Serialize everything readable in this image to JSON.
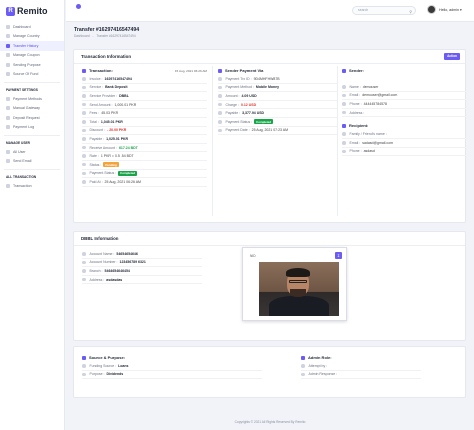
{
  "brand": {
    "name": "Remito",
    "logo_letter": "R"
  },
  "sidebar": {
    "main_items": [
      {
        "label": "Dashboard",
        "icon": "dashboard-icon"
      },
      {
        "label": "Manage Country",
        "icon": "globe-icon"
      },
      {
        "label": "Transfer History",
        "icon": "history-icon"
      },
      {
        "label": "Manage Coupon",
        "icon": "coupon-icon"
      },
      {
        "label": "Sending Purpose",
        "icon": "purpose-icon"
      },
      {
        "label": "Source Of Fund",
        "icon": "fund-icon"
      }
    ],
    "payment_heading": "PAYMENT SETTINGS",
    "payment_items": [
      {
        "label": "Payment Methods",
        "icon": "card-icon"
      },
      {
        "label": "Manual Gateway",
        "icon": "gateway-icon"
      },
      {
        "label": "Deposit Request",
        "icon": "deposit-icon"
      },
      {
        "label": "Payment Log",
        "icon": "log-icon"
      }
    ],
    "user_heading": "MANAGE USER",
    "user_items": [
      {
        "label": "All User",
        "icon": "users-icon"
      },
      {
        "label": "Send Email",
        "icon": "mail-icon"
      }
    ],
    "transaction_heading": "ALL TRANSACTION",
    "transaction_items": [
      {
        "label": "Transaction",
        "icon": "transaction-icon"
      }
    ]
  },
  "topbar": {
    "search_placeholder": "search",
    "greeting": "Hello, admin"
  },
  "page": {
    "title": "Transfer #162974165474​94",
    "breadcrumb": [
      "Dashboard",
      "-",
      "Transfer #162974165474​94"
    ]
  },
  "transaction_card": {
    "title": "Transaction Information",
    "action_label": "Action",
    "transaction": {
      "heading": "Transaction:",
      "date": "15 Aug, 2021 06:26 AM",
      "rows": [
        {
          "label": "Invoice :",
          "value": "16297416547494",
          "style": "bold"
        },
        {
          "label": "Service :",
          "value": "Bank Deposit",
          "style": "bold"
        },
        {
          "label": "Service Provider :",
          "value": "DBBL",
          "style": "bold"
        },
        {
          "label": "Send Amount :",
          "value": "1,000.01 PKR",
          "style": "plain"
        },
        {
          "label": "Fees :",
          "value": "45.03 PKR",
          "style": "plain"
        },
        {
          "label": "Total :",
          "value": "1,045.01 PKR",
          "style": "bold"
        },
        {
          "label": "Discount :",
          "value": "- 20.00 PKR",
          "style": "red"
        },
        {
          "label": "Payable :",
          "value": "1,025.01 PKR",
          "style": "bold"
        },
        {
          "label": "Receive Amount :",
          "value": "617.24 BDT",
          "style": "green"
        },
        {
          "label": "Rate :",
          "value": "1 PKR = 0.5 .54 BDT",
          "style": "plain"
        },
        {
          "label": "Status :",
          "badge": "Pending",
          "badge_type": "pending"
        },
        {
          "label": "Payment Status :",
          "badge": "Completed",
          "badge_type": "completed"
        },
        {
          "label": "Paid At :",
          "value": "25 Aug, 2021 06:26 AM",
          "style": "plain"
        }
      ]
    },
    "sender_payment": {
      "heading": "Sender Payment Via",
      "rows": [
        {
          "label": "Payment Trx ID :",
          "value": "9D4MHFHW87B",
          "style": "plain"
        },
        {
          "label": "Payment Method :",
          "value": "Mobile Money",
          "style": "bold"
        },
        {
          "label": "Amount :",
          "value": "4.09 USD",
          "style": "bold"
        },
        {
          "label": "Charge :",
          "value": "0.12 USD",
          "style": "red"
        },
        {
          "label": "Payable :",
          "value": "3,377.94 USD",
          "style": "bold"
        },
        {
          "label": "Payment Status :",
          "badge": "Completed",
          "badge_type": "completed"
        },
        {
          "label": "Payment Date :",
          "value": "25 Aug, 2021 07:23 AM",
          "style": "plain"
        }
      ]
    },
    "sender": {
      "heading": "Sender:",
      "rows": [
        {
          "label": "Name :",
          "value": "demouser",
          "style": "plain"
        },
        {
          "label": "Email :",
          "value": "demouser@gmail.com",
          "style": "plain"
        },
        {
          "label": "Phone :",
          "value": "444445784578",
          "style": "plain"
        },
        {
          "label": "Address :",
          "value": "",
          "style": "plain"
        }
      ]
    },
    "recipient": {
      "heading": "Recipient:",
      "rows": [
        {
          "label": "Family / Friend's name :",
          "value": "",
          "style": "plain"
        },
        {
          "label": "Email :",
          "value": "sadasd@gmail.com",
          "style": "plain"
        },
        {
          "label": "Phone :",
          "value": "asdasd",
          "style": "plain"
        }
      ]
    }
  },
  "dbbl_card": {
    "title": "DBBL Information",
    "rows": [
      {
        "label": "Account Name :",
        "value": "54654654646"
      },
      {
        "label": "Account Number :",
        "value": "123456789 6321"
      },
      {
        "label": "Branch :",
        "value": "5464654646454"
      },
      {
        "label": "Address :",
        "value": "asdasdas"
      }
    ],
    "id_card": {
      "label": "NID"
    }
  },
  "bottom_card": {
    "source_heading": "Source & Purpose:",
    "source_rows": [
      {
        "label": "Funding Source :",
        "value": "Loans"
      },
      {
        "label": "Purpose :",
        "value": "Dividends"
      }
    ],
    "admin_heading": "Admin Role:",
    "admin_rows": [
      {
        "label": "Attempt by :",
        "value": ""
      },
      {
        "label": "Admin Response :",
        "value": ""
      }
    ]
  },
  "footer": {
    "text": "Copyrights © 2021 All Rights Reserved By Remito"
  }
}
